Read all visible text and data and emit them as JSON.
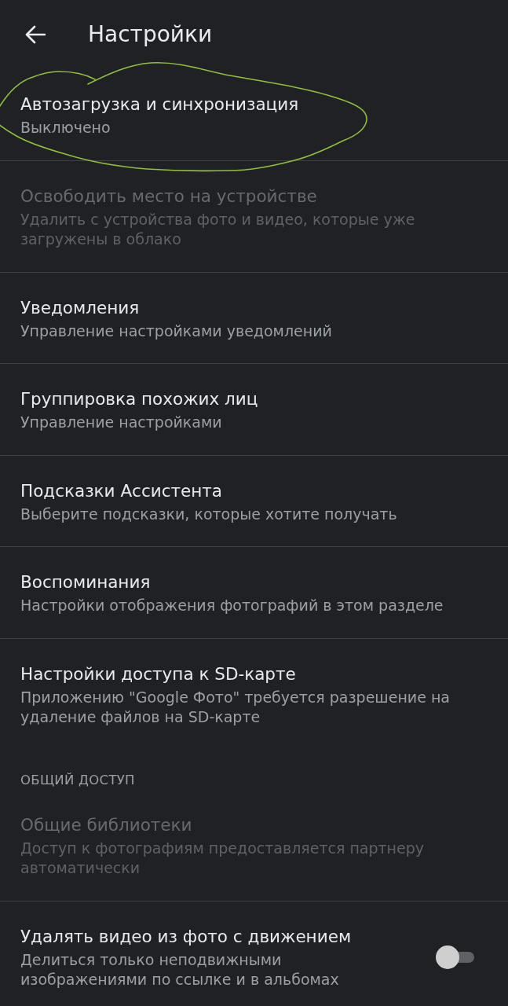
{
  "header": {
    "title": "Настройки"
  },
  "items": [
    {
      "kind": "setting",
      "title": "Автозагрузка и синхронизация",
      "subtitle": "Выключено",
      "disabled": false,
      "circled": true
    },
    {
      "kind": "setting",
      "title": "Освободить место на устройстве",
      "subtitle": "Удалить с устройства фото и видео, которые уже загружены в облако",
      "disabled": true,
      "circled": false
    },
    {
      "kind": "setting",
      "title": "Уведомления",
      "subtitle": "Управление настройками уведомлений",
      "disabled": false,
      "circled": false
    },
    {
      "kind": "setting",
      "title": "Группировка похожих лиц",
      "subtitle": "Управление настройками",
      "disabled": false,
      "circled": false
    },
    {
      "kind": "setting",
      "title": "Подсказки Ассистента",
      "subtitle": "Выберите подсказки, которые хотите получать",
      "disabled": false,
      "circled": false
    },
    {
      "kind": "setting",
      "title": "Воспоминания",
      "subtitle": "Настройки отображения фотографий в этом разделе",
      "disabled": false,
      "circled": false
    },
    {
      "kind": "setting",
      "title": "Настройки доступа к SD-карте",
      "subtitle": "Приложению \"Google Фото\" требуется разрешение на удаление файлов на SD-карте",
      "disabled": false,
      "circled": false
    },
    {
      "kind": "section",
      "title": "ОБЩИЙ ДОСТУП"
    },
    {
      "kind": "setting",
      "title": "Общие библиотеки",
      "subtitle": "Доступ к фотографиям предоставляется партнеру автоматически",
      "disabled": true,
      "circled": false
    },
    {
      "kind": "switch",
      "title": "Удалять видео из фото с движением",
      "subtitle": "Делиться только неподвижными изображениями по ссылке и в альбомах",
      "disabled": false,
      "circled": false,
      "on": false
    }
  ]
}
